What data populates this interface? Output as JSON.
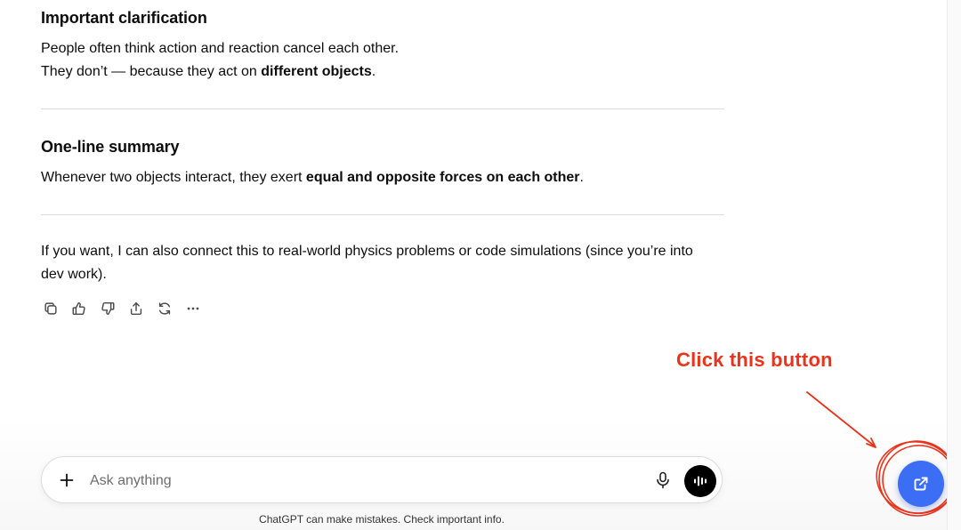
{
  "conversation": {
    "clarification": {
      "heading": "Important clarification",
      "line1": "People often think action and reaction cancel each other.",
      "line2_prefix": "They don’t — because they act on ",
      "line2_bold": "different objects",
      "line2_suffix": "."
    },
    "summary": {
      "heading": "One-line summary",
      "prefix": "Whenever two objects interact, they exert ",
      "bold": "equal and opposite forces on each other",
      "suffix": "."
    },
    "offer": {
      "line1": "If you want, I can also connect this to real-world physics problems or code simulations (since you’re into",
      "line2": "dev work)."
    }
  },
  "message_actions": [
    {
      "name": "copy",
      "icon": "copy-icon"
    },
    {
      "name": "good-response",
      "icon": "thumbs-up-icon"
    },
    {
      "name": "bad-response",
      "icon": "thumbs-down-icon"
    },
    {
      "name": "share",
      "icon": "share-icon"
    },
    {
      "name": "regenerate",
      "icon": "refresh-icon"
    },
    {
      "name": "more",
      "icon": "more-icon"
    }
  ],
  "composer": {
    "placeholder": "Ask anything"
  },
  "disclaimer": "ChatGPT can make mistakes. Check important info.",
  "annotation": {
    "text": "Click this button",
    "color": "#e8341c"
  },
  "floating_button": {
    "icon": "external-link-icon",
    "color": "#3b6ef5"
  }
}
